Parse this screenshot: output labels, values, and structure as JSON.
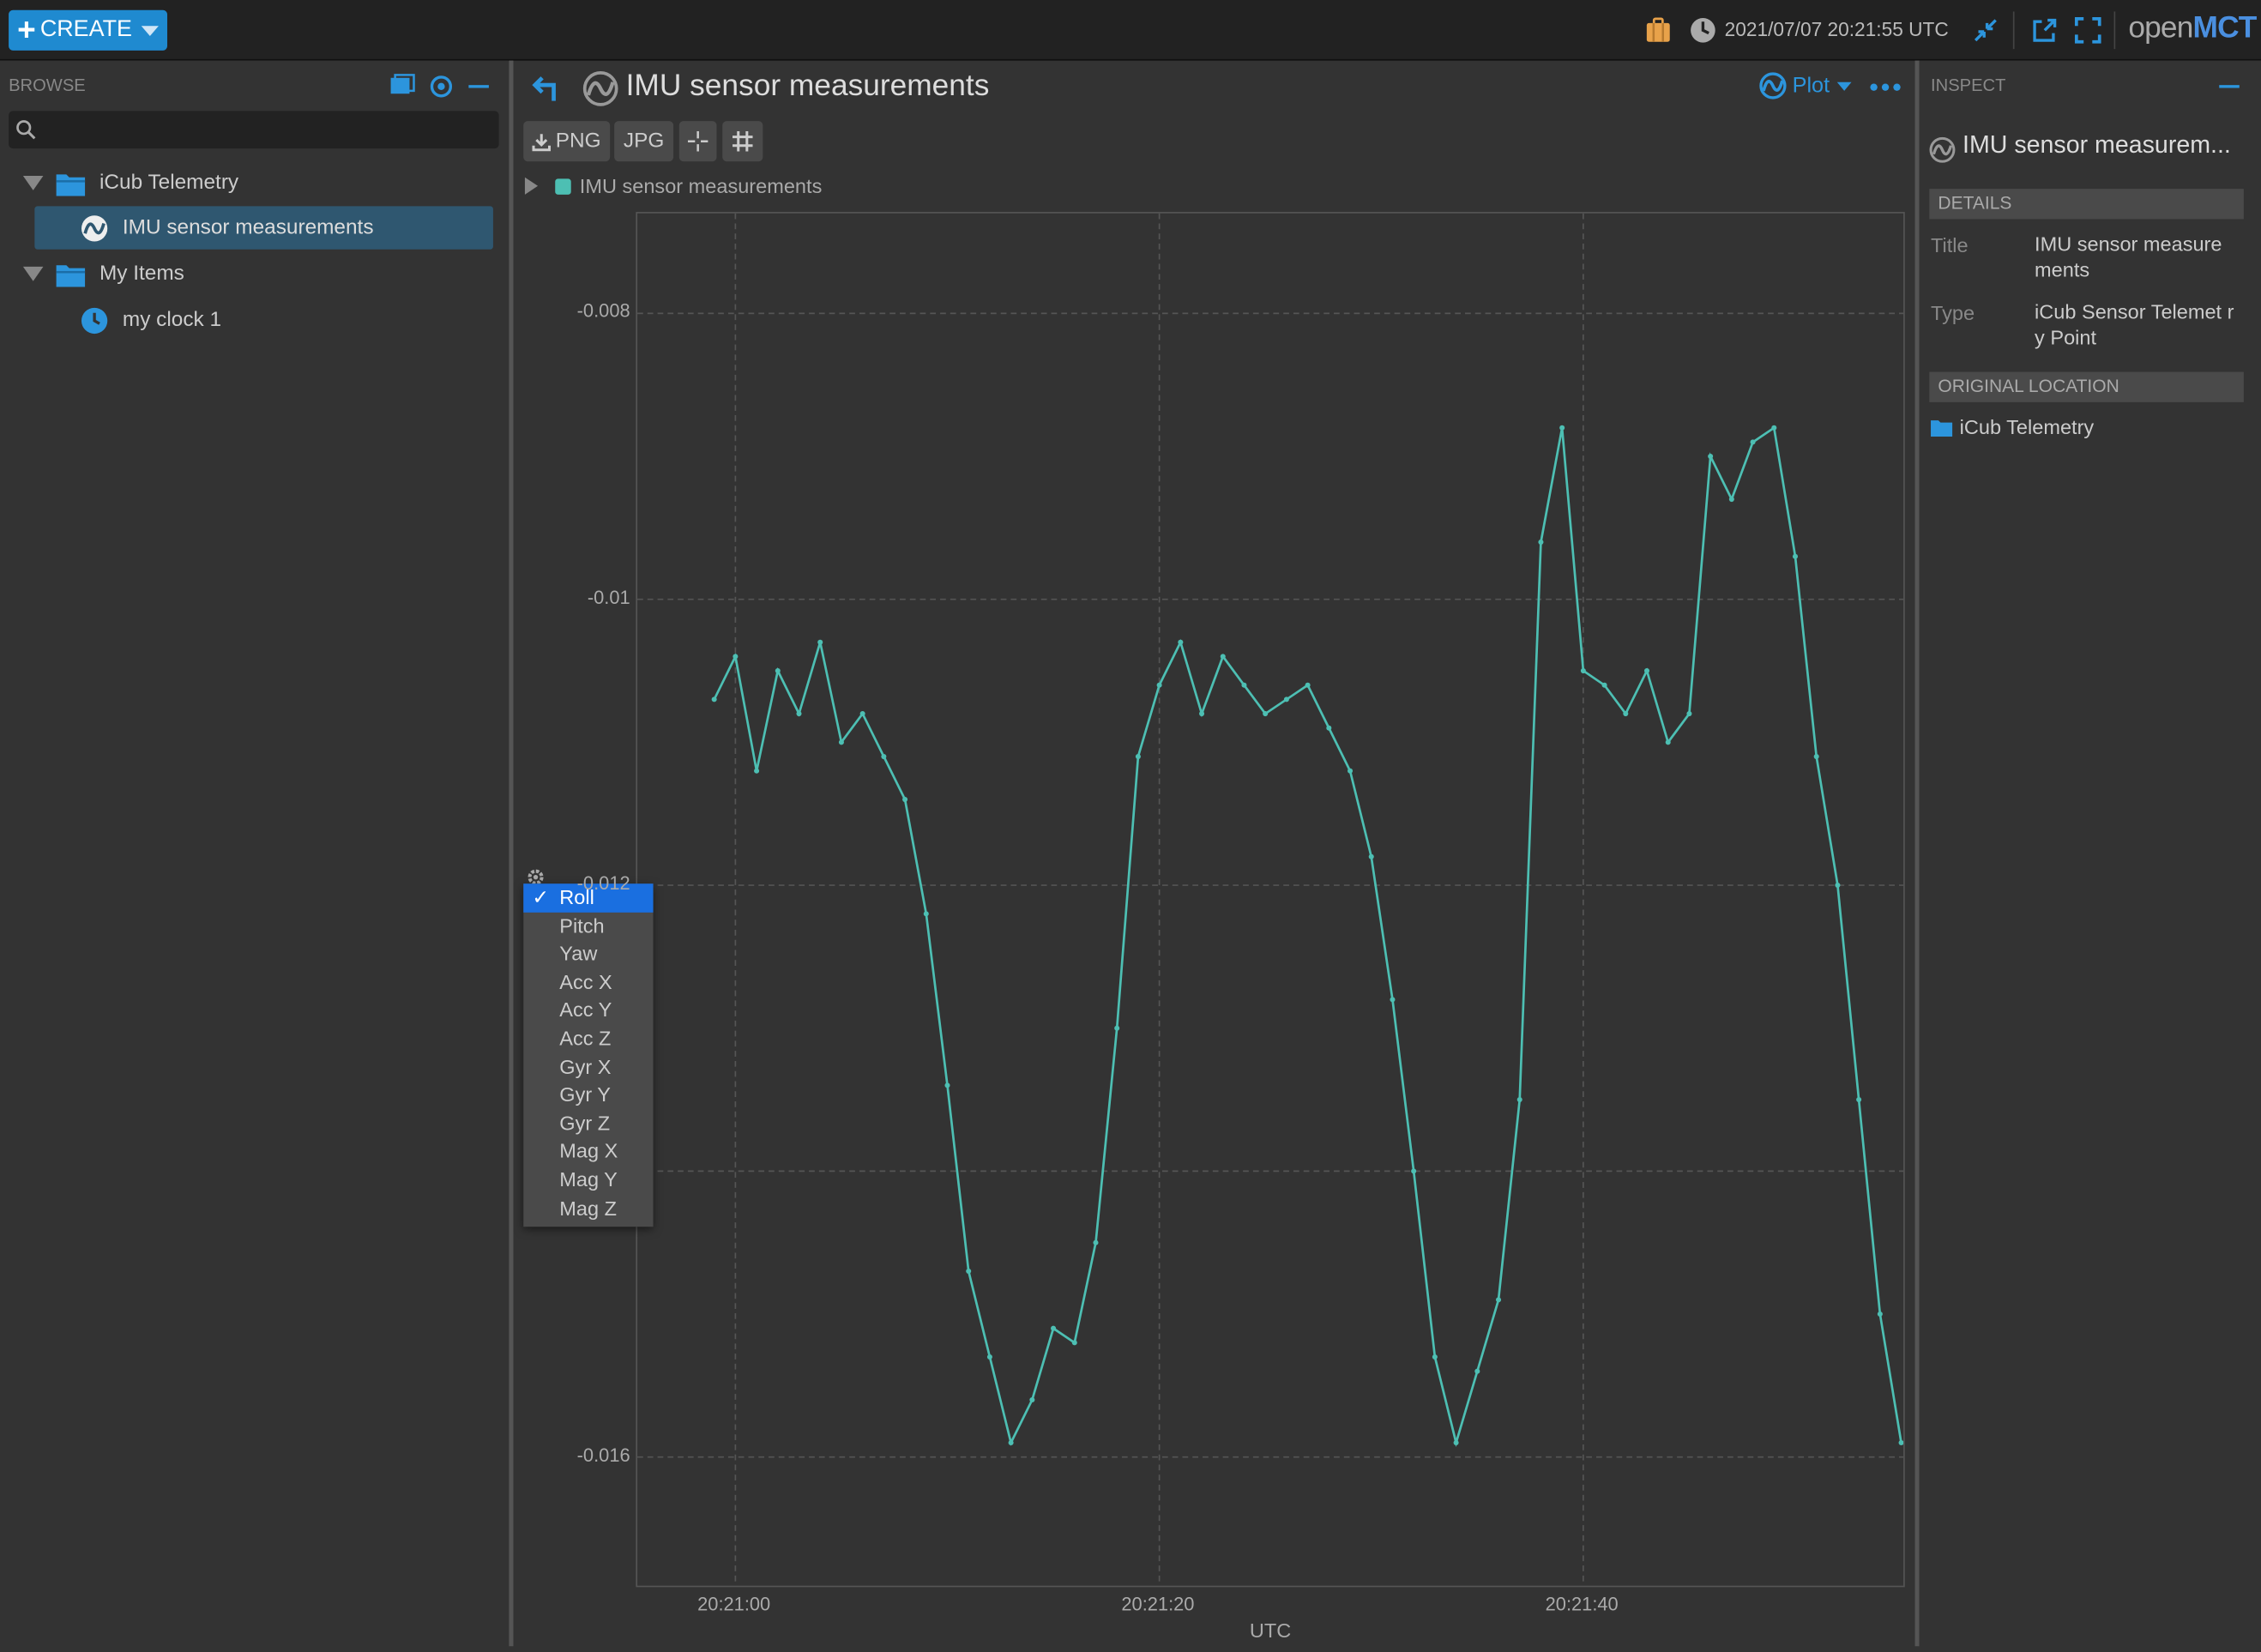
{
  "topbar": {
    "create_label": "CREATE",
    "datetime": "2021/07/07 20:21:55 UTC",
    "logo_open": "open",
    "logo_mct": "MCT",
    "icons": [
      "briefcase-icon",
      "clock-icon",
      "shrink-icon",
      "new-window-icon",
      "fullscreen-icon"
    ]
  },
  "browse": {
    "header": "BROWSE",
    "search_placeholder": "",
    "tree": [
      {
        "label": "iCub Telemetry",
        "type": "folder",
        "expanded": true
      },
      {
        "label": "IMU sensor measurements",
        "type": "telemetry",
        "selected": true
      },
      {
        "label": "My Items",
        "type": "folder",
        "expanded": true
      },
      {
        "label": "my clock 1",
        "type": "clock"
      }
    ]
  },
  "main": {
    "title": "IMU sensor measurements",
    "view_label": "Plot",
    "toolbar": {
      "png": "PNG",
      "jpg": "JPG"
    },
    "legend_label": "IMU sensor measurements",
    "series_color": "#4dbfb3"
  },
  "chart_data": {
    "type": "line",
    "title": "",
    "xlabel": "UTC",
    "ylabel": "",
    "series": [
      {
        "name": "IMU sensor measurements",
        "color": "#4dbfb3",
        "points": [
          [
            "20:20:59",
            "-0.0107"
          ],
          [
            "20:21:00",
            "-0.0104"
          ],
          [
            "20:21:01",
            "-0.0112"
          ],
          [
            "20:21:02",
            "-0.0105"
          ],
          [
            "20:21:03",
            "-0.0108"
          ],
          [
            "20:21:04",
            "-0.0103"
          ],
          [
            "20:21:05",
            "-0.0110"
          ],
          [
            "20:21:06",
            "-0.0108"
          ],
          [
            "20:21:07",
            "-0.0111"
          ],
          [
            "20:21:08",
            "-0.0114"
          ],
          [
            "20:21:09",
            "-0.0122"
          ],
          [
            "20:21:10",
            "-0.0134"
          ],
          [
            "20:21:11",
            "-0.0147"
          ],
          [
            "20:21:12",
            "-0.0153"
          ],
          [
            "20:21:13",
            "-0.0159"
          ],
          [
            "20:21:14",
            "-0.0156"
          ],
          [
            "20:21:15",
            "-0.0151"
          ],
          [
            "20:21:16",
            "-0.0152"
          ],
          [
            "20:21:17",
            "-0.0145"
          ],
          [
            "20:21:18",
            "-0.0130"
          ],
          [
            "20:21:19",
            "-0.0111"
          ],
          [
            "20:21:20",
            "-0.0106"
          ],
          [
            "20:21:21",
            "-0.0103"
          ],
          [
            "20:21:22",
            "-0.0108"
          ],
          [
            "20:21:23",
            "-0.0104"
          ],
          [
            "20:21:24",
            "-0.0106"
          ],
          [
            "20:21:25",
            "-0.0108"
          ],
          [
            "20:21:26",
            "-0.0107"
          ],
          [
            "20:21:27",
            "-0.0106"
          ],
          [
            "20:21:28",
            "-0.0109"
          ],
          [
            "20:21:29",
            "-0.0112"
          ],
          [
            "20:21:30",
            "-0.0118"
          ],
          [
            "20:21:31",
            "-0.0128"
          ],
          [
            "20:21:32",
            "-0.0140"
          ],
          [
            "20:21:33",
            "-0.0153"
          ],
          [
            "20:21:34",
            "-0.0159"
          ],
          [
            "20:21:35",
            "-0.0154"
          ],
          [
            "20:21:36",
            "-0.0149"
          ],
          [
            "20:21:37",
            "-0.0135"
          ],
          [
            "20:21:38",
            "-0.0096"
          ],
          [
            "20:21:39",
            "-0.0088"
          ],
          [
            "20:21:40",
            "-0.0105"
          ],
          [
            "20:21:41",
            "-0.0106"
          ],
          [
            "20:21:42",
            "-0.0108"
          ],
          [
            "20:21:43",
            "-0.0105"
          ],
          [
            "20:21:44",
            "-0.0110"
          ],
          [
            "20:21:45",
            "-0.0108"
          ],
          [
            "20:21:46",
            "-0.0090"
          ],
          [
            "20:21:47",
            "-0.0093"
          ],
          [
            "20:21:48",
            "-0.0089"
          ],
          [
            "20:21:49",
            "-0.0088"
          ],
          [
            "20:21:50",
            "-0.0097"
          ],
          [
            "20:21:51",
            "-0.0111"
          ],
          [
            "20:21:52",
            "-0.0120"
          ],
          [
            "20:21:53",
            "-0.0135"
          ],
          [
            "20:21:54",
            "-0.0150"
          ],
          [
            "20:21:55",
            "-0.0159"
          ]
        ]
      }
    ],
    "yticks": [
      "-0.008",
      "-0.01",
      "-0.012",
      "-0.016"
    ],
    "xticks": [
      "20:21:00",
      "20:21:20",
      "20:21:40"
    ],
    "ylim": [
      -0.0169,
      -0.0073
    ],
    "grid": true
  },
  "y_axis_menu": {
    "items": [
      "Roll",
      "Pitch",
      "Yaw",
      "Acc X",
      "Acc Y",
      "Acc Z",
      "Gyr X",
      "Gyr Y",
      "Gyr Z",
      "Mag X",
      "Mag Y",
      "Mag Z"
    ],
    "selected": "Roll",
    "check": "✓"
  },
  "inspect": {
    "header": "INSPECT",
    "object_title": "IMU sensor measurem...",
    "details_header": "DETAILS",
    "title_label": "Title",
    "title_value": "IMU sensor measure ments",
    "type_label": "Type",
    "type_value": "iCub Sensor Telemet ry Point",
    "location_header": "ORIGINAL LOCATION",
    "location_value": "iCub Telemetry"
  }
}
